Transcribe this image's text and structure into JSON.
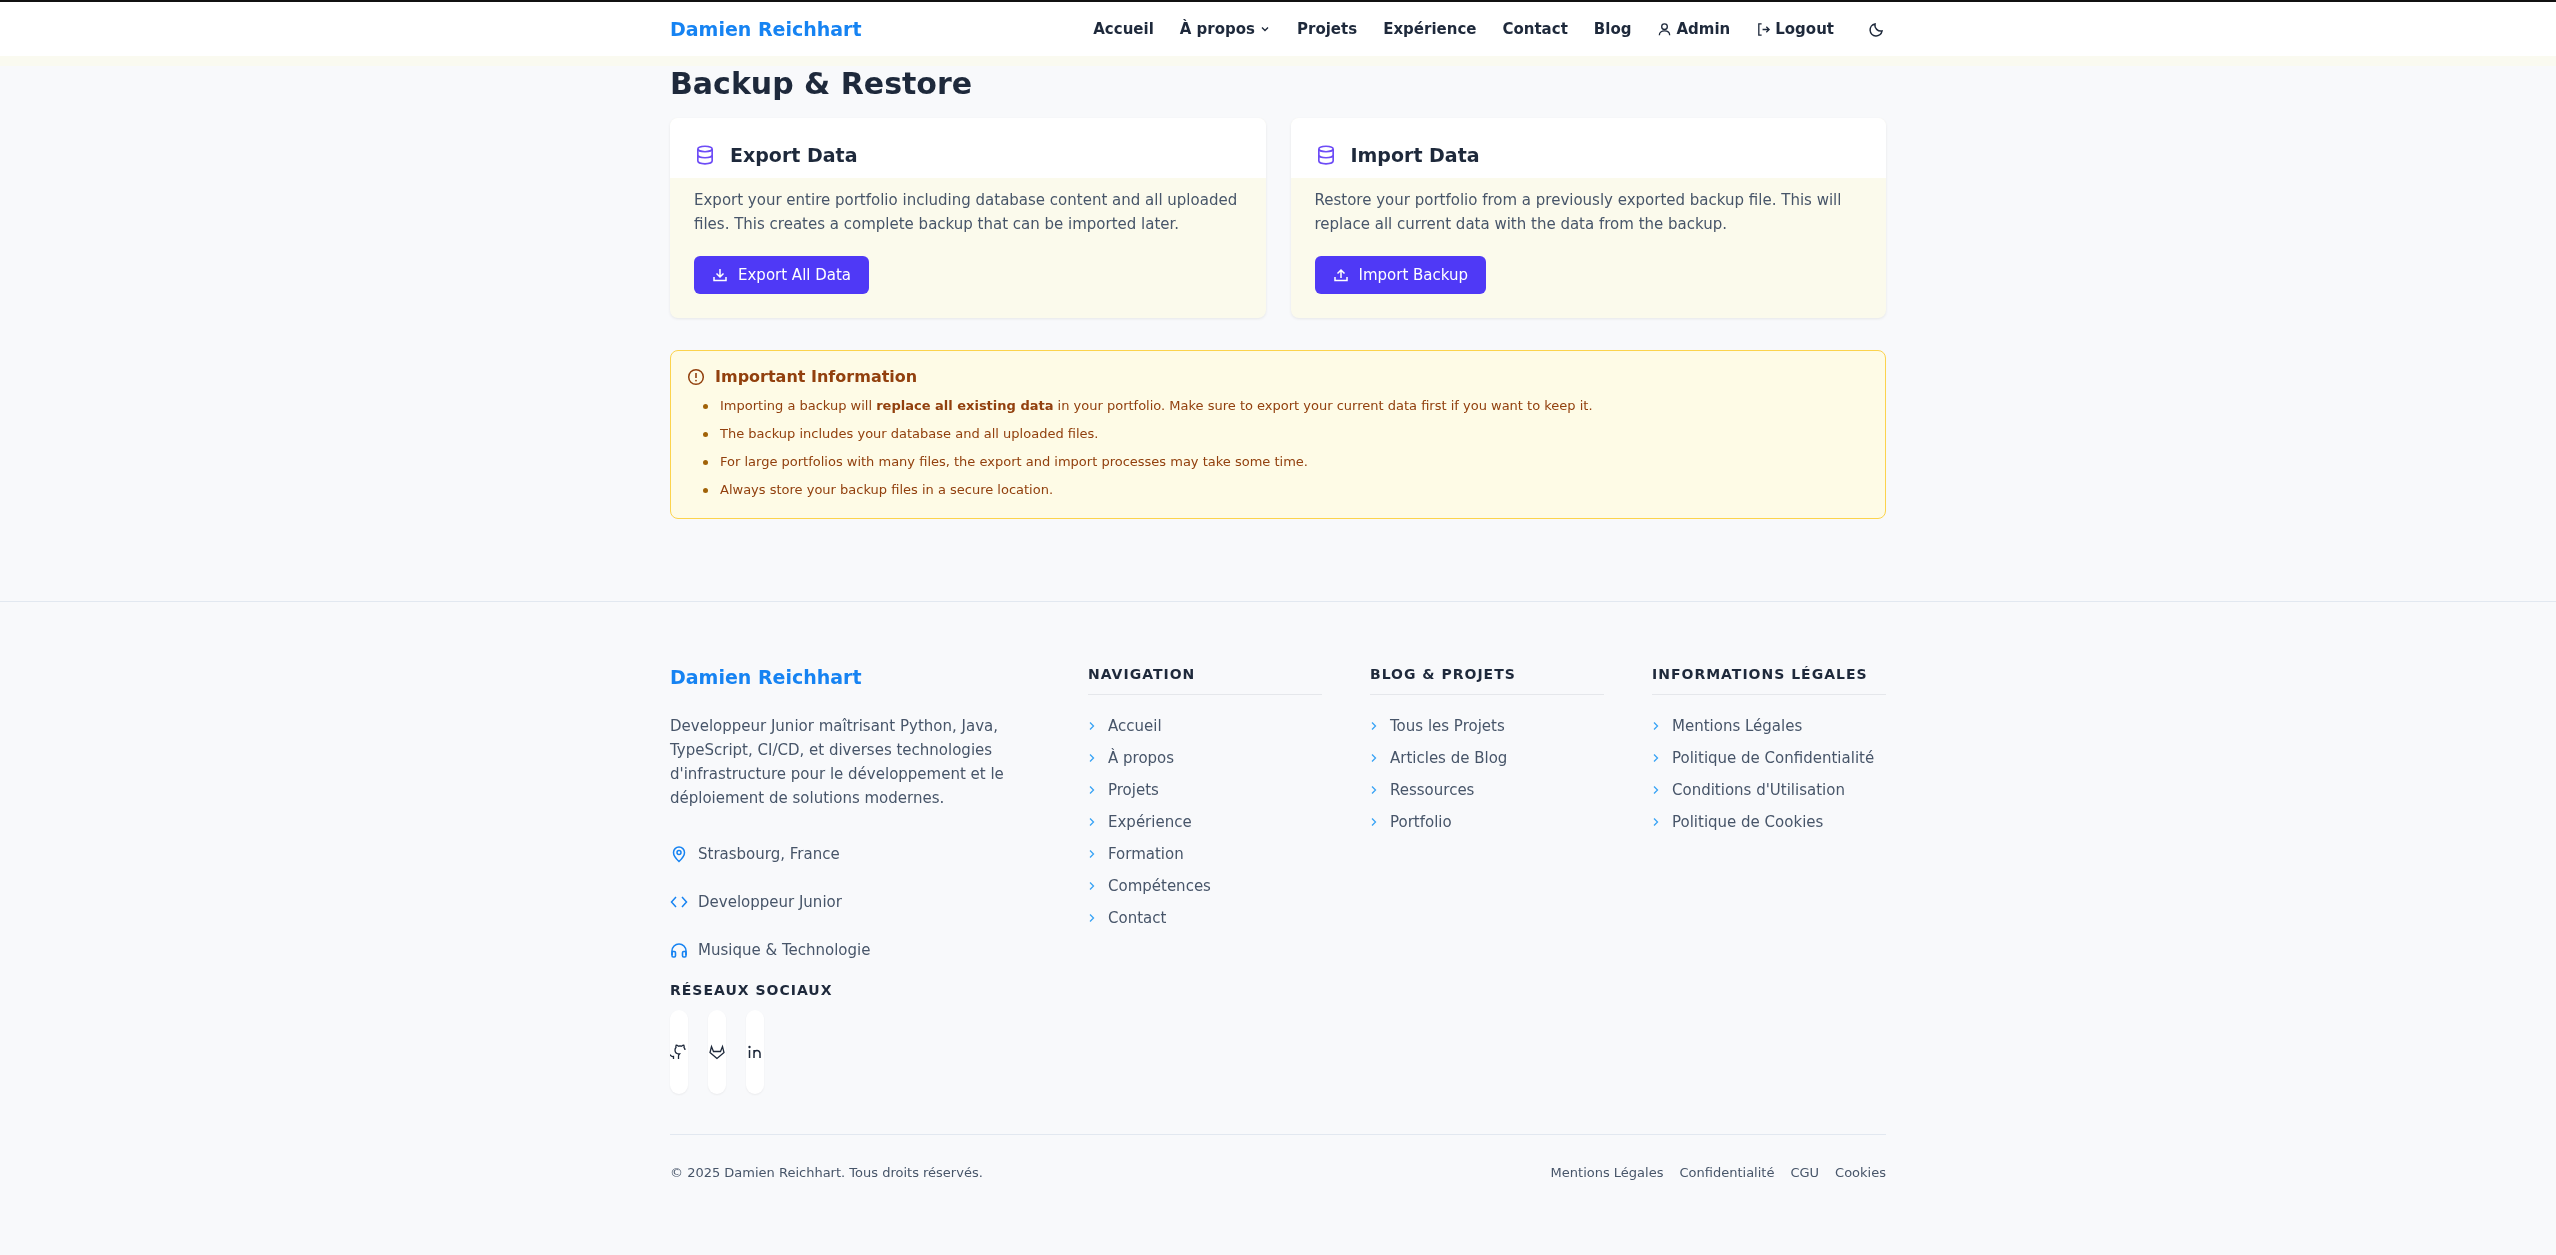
{
  "header": {
    "brand": "Damien Reichhart",
    "nav": [
      {
        "label": "Accueil",
        "kind": "link"
      },
      {
        "label": "À propos",
        "kind": "dropdown"
      },
      {
        "label": "Projets",
        "kind": "link"
      },
      {
        "label": "Expérience",
        "kind": "link"
      },
      {
        "label": "Contact",
        "kind": "link"
      },
      {
        "label": "Blog",
        "kind": "link"
      },
      {
        "label": "Admin",
        "kind": "user"
      },
      {
        "label": "Logout",
        "kind": "logout"
      }
    ]
  },
  "page": {
    "title": "Backup & Restore"
  },
  "cards": [
    {
      "kind": "export",
      "title": "Export Data",
      "text": "Export your entire portfolio including database content and all uploaded files. This creates a complete backup that can be imported later.",
      "button": "Export All Data"
    },
    {
      "kind": "import",
      "title": "Import Data",
      "text": "Restore your portfolio from a previously exported backup file. This will replace all current data with the data from the backup.",
      "button": "Import Backup"
    }
  ],
  "info": {
    "title": "Important Information",
    "items": [
      "Importing a backup will **replace all existing data** in your portfolio. Make sure to export your current data first if you want to keep it.",
      "The backup includes your database and all uploaded files.",
      "For large portfolios with many files, the export and import processes may take some time.",
      "Always store your backup files in a secure location."
    ]
  },
  "footer": {
    "brand": "Damien Reichhart",
    "about": "Developpeur Junior maîtrisant Python, Java, TypeScript, CI/CD, et diverses technologies d'infrastructure pour le développement et le déploiement de solutions modernes.",
    "contacts": [
      {
        "kind": "location",
        "text": "Strasbourg, France"
      },
      {
        "kind": "code",
        "text": "Developpeur Junior"
      },
      {
        "kind": "music",
        "text": "Musique & Technologie"
      }
    ],
    "social_title": "RÉSEAUX SOCIAUX",
    "socials": [
      {
        "kind": "github"
      },
      {
        "kind": "gitlab"
      },
      {
        "kind": "linkedin"
      }
    ],
    "columns": [
      {
        "title": "NAVIGATION",
        "links": [
          "Accueil",
          "À propos",
          "Projets",
          "Expérience",
          "Formation",
          "Compétences",
          "Contact"
        ]
      },
      {
        "title": "BLOG & PROJETS",
        "links": [
          "Tous les Projets",
          "Articles de Blog",
          "Ressources",
          "Portfolio"
        ]
      },
      {
        "title": "INFORMATIONS LÉGALES",
        "links": [
          "Mentions Légales",
          "Politique de Confidentialité",
          "Conditions d'Utilisation",
          "Politique de Cookies"
        ]
      }
    ],
    "copyright": "© 2025 Damien Reichhart. Tous droits réservés.",
    "bottom_links": [
      "Mentions Légales",
      "Confidentialité",
      "CGU",
      "Cookies"
    ]
  }
}
